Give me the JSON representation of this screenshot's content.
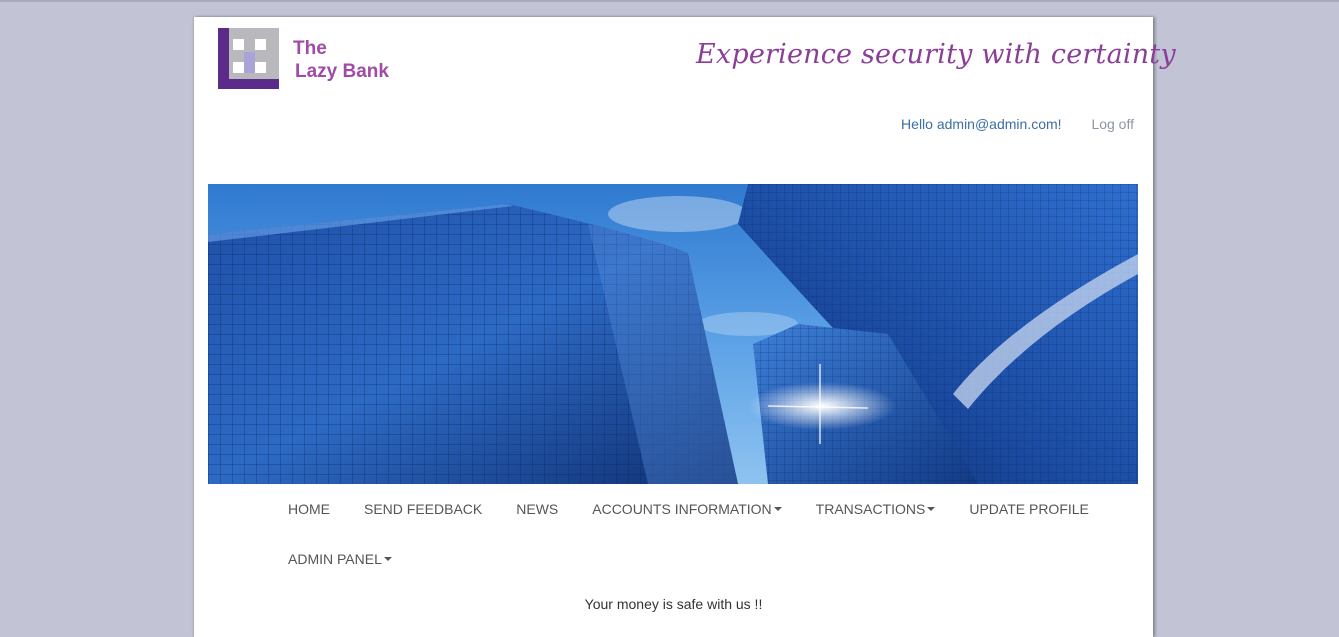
{
  "brand": {
    "line1": "The",
    "line2": "Lazy Bank",
    "tagline": "Experience security with certainty",
    "color": "#a14aa6"
  },
  "user": {
    "greeting": "Hello admin@admin.com!",
    "logoff": "Log off"
  },
  "nav": {
    "row1": [
      {
        "label": "HOME",
        "dropdown": false
      },
      {
        "label": "SEND FEEDBACK",
        "dropdown": false
      },
      {
        "label": "NEWS",
        "dropdown": false
      },
      {
        "label": "ACCOUNTS INFORMATION",
        "dropdown": true
      },
      {
        "label": "TRANSACTIONS",
        "dropdown": true
      },
      {
        "label": "UPDATE PROFILE",
        "dropdown": false
      }
    ],
    "row2": [
      {
        "label": "ADMIN PANEL",
        "dropdown": true
      }
    ]
  },
  "footer": {
    "text": "Your money is safe with us !!"
  },
  "colors": {
    "page_bg": "#c2c4d6",
    "sky": "#4a8fd8",
    "nav_text": "#555555"
  }
}
